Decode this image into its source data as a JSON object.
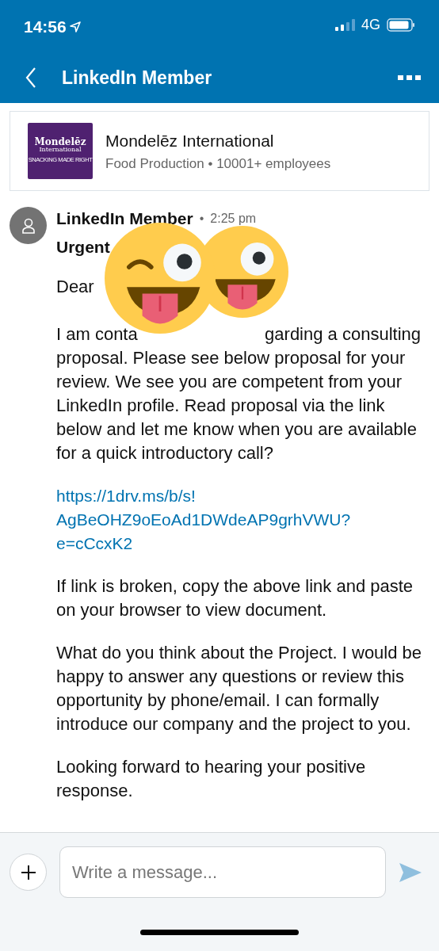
{
  "status_bar": {
    "time": "14:56",
    "network": "4G"
  },
  "nav": {
    "title": "LinkedIn Member"
  },
  "company": {
    "logo": {
      "name": "Mondelēz",
      "sub": "International",
      "tagline": "SNACKING MADE RIGHT"
    },
    "name": "Mondelēz International",
    "details": "Food Production • 10001+ employees"
  },
  "message": {
    "sender": "LinkedIn Member",
    "separator": "•",
    "time": "2:25 pm",
    "subject": "Urgent",
    "greeting": "Dear",
    "first_line_fragments": [
      "I am conta",
      "garding a consulting"
    ],
    "paragraph_rest": "proposal. Please see below proposal for your review. We see you are competent from your LinkedIn profile. Read proposal via the link below and let me know when you are available for a quick introductory call?",
    "link_lines": [
      "https://1drv.ms/b/s!",
      "AgBeOHZ9oEoAd1DWdeAP9grhVWU?",
      "e=cCcxK2"
    ],
    "paragraphs": [
      "If link is broken, copy the above link and paste on your browser to view document.",
      "What do you think about the Project. I would be happy to answer any questions or review this opportunity by phone/email. I can formally introduce our company and the project to you.",
      "Looking forward to hearing your positive response."
    ]
  },
  "stickers": [
    {
      "kind": "wink"
    },
    {
      "kind": "crazy"
    }
  ],
  "composer": {
    "placeholder": "Write a message..."
  }
}
